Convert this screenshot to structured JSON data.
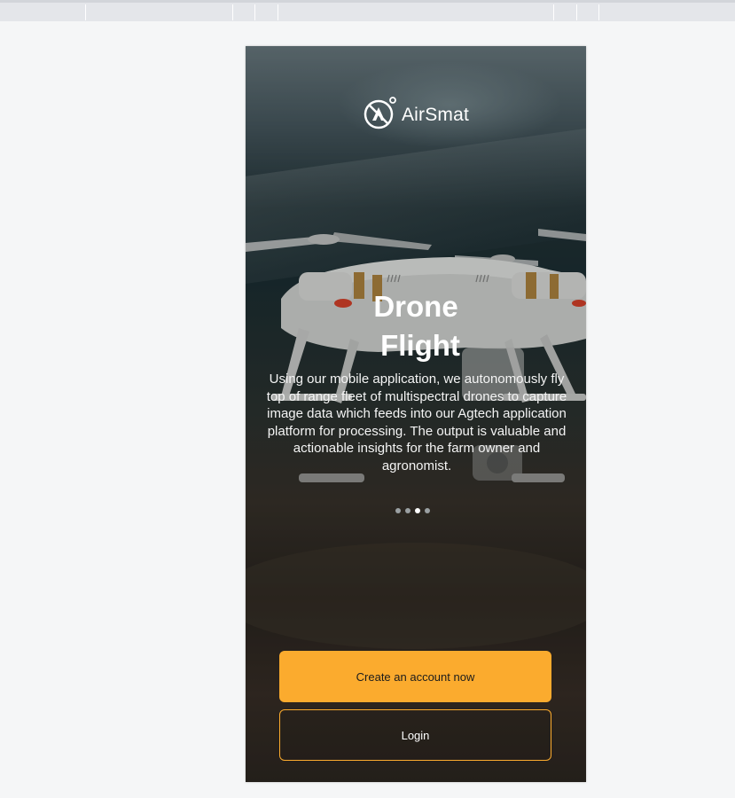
{
  "app": {
    "brand_name": "AirSmat",
    "brand_color": "#fbab2e"
  },
  "slide": {
    "title_line1": "Drone",
    "title_line2": "Flight",
    "description": "Using our mobile application, we autonomously fly top of range fleet of multispectral drones to capture image data which feeds into our Agtech application platform for processing. The output is valuable and actionable insights for the farm owner and agronomist.",
    "total_slides": 4,
    "active_slide": 3
  },
  "actions": {
    "create_account_label": "Create an account now",
    "login_label": "Login"
  },
  "icons": {
    "logo": "airsmat-logo-icon"
  }
}
